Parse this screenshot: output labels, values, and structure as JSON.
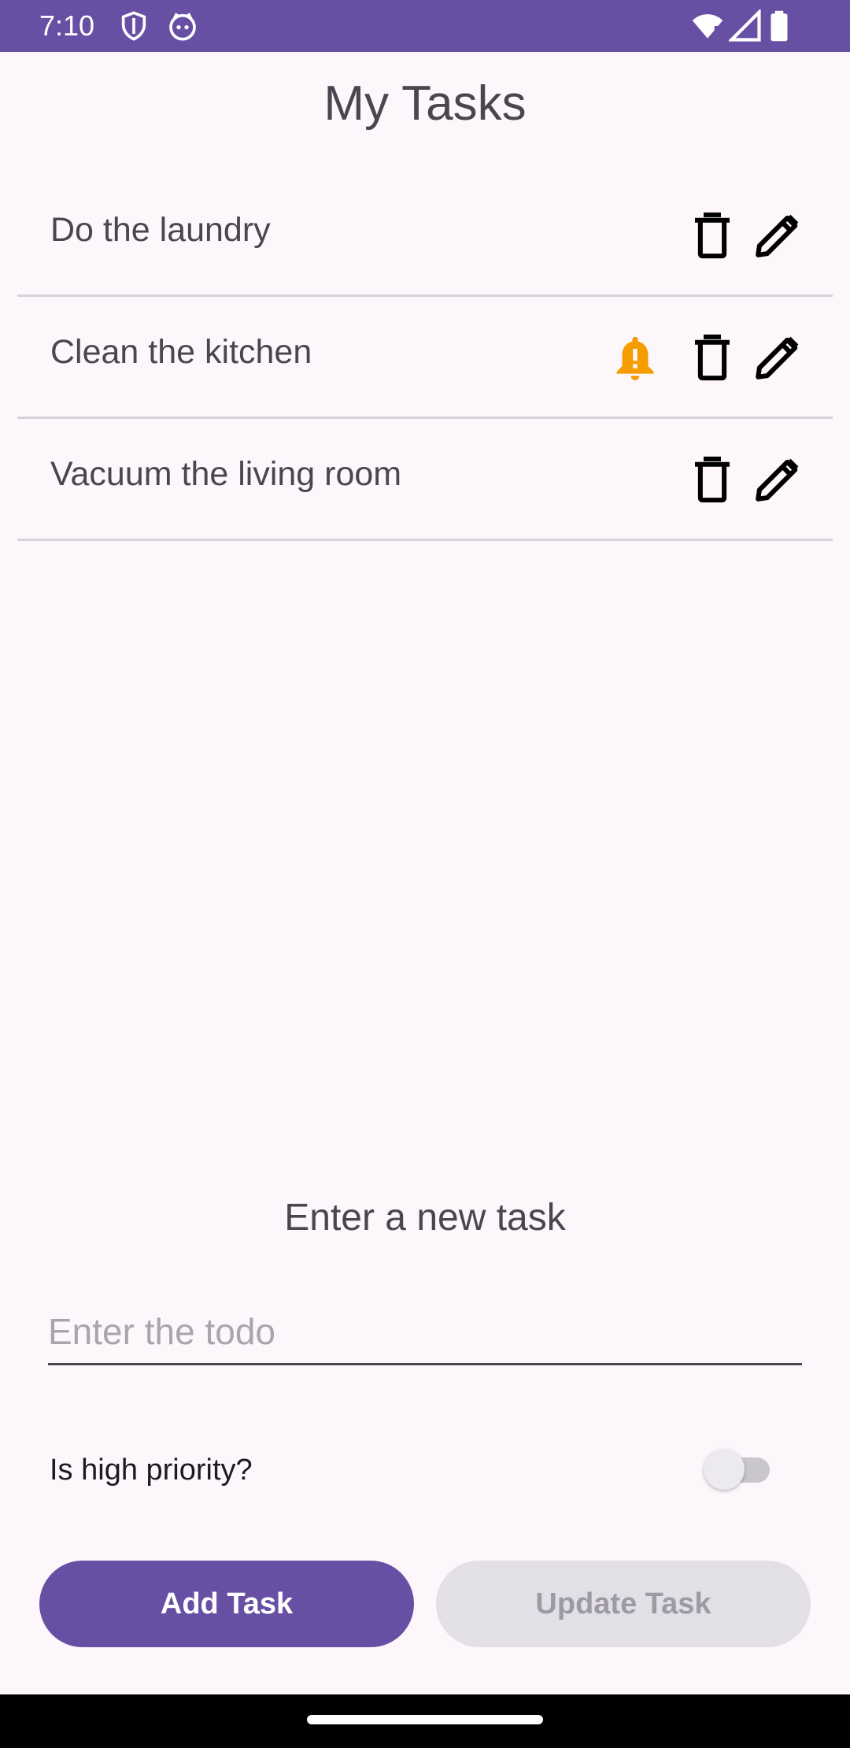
{
  "status_bar": {
    "time": "7:10",
    "left_icons": [
      "shield-icon",
      "cat-icon"
    ],
    "right_icons": [
      "wifi-icon",
      "signal-icon",
      "battery-icon"
    ],
    "background_color": "#6750a4"
  },
  "header": {
    "title": "My Tasks"
  },
  "tasks": [
    {
      "label": "Do the laundry",
      "high_priority": false,
      "icons": [
        "delete-icon",
        "edit-icon"
      ]
    },
    {
      "label": "Clean the kitchen",
      "high_priority": true,
      "icons": [
        "priority-bell-icon",
        "delete-icon",
        "edit-icon"
      ]
    },
    {
      "label": "Vacuum the living room",
      "high_priority": false,
      "icons": [
        "delete-icon",
        "edit-icon"
      ]
    }
  ],
  "form": {
    "heading": "Enter a new task",
    "todo_value": "",
    "todo_placeholder": "Enter the todo",
    "priority_label": "Is high priority?",
    "priority_on": false,
    "add_label": "Add Task",
    "update_label": "Update Task",
    "update_enabled": false
  },
  "colors": {
    "accent": "#6750a4",
    "priority_bell": "#f59c00",
    "background": "#fdf7fc"
  }
}
